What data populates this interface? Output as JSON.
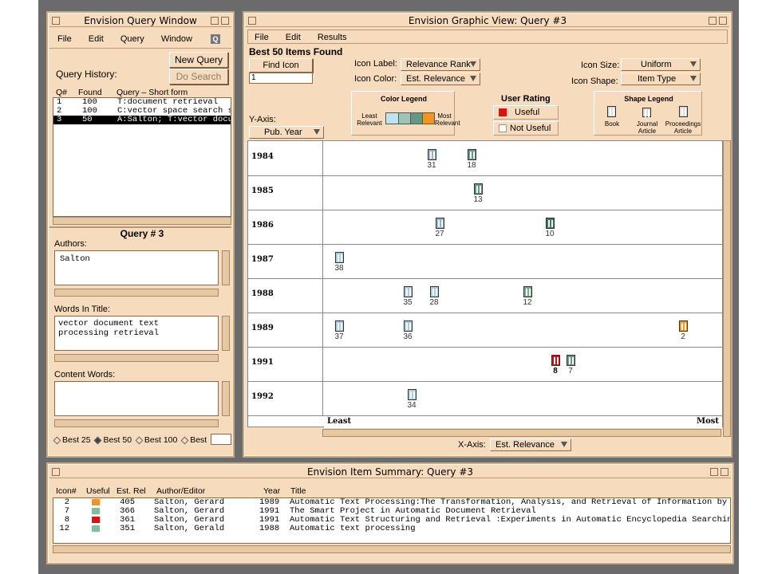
{
  "query_window": {
    "title": "Envision Query Window",
    "menu": [
      "File",
      "Edit",
      "Query",
      "Window"
    ],
    "q_badge": "Q",
    "new_query": "New Query",
    "do_search": "Do Search",
    "history_label": "Query History:",
    "history_headers": [
      "Q#",
      "Found",
      "Query – Short form"
    ],
    "history": [
      {
        "q": "1",
        "found": "100",
        "text": "T:document retrieval"
      },
      {
        "q": "2",
        "found": "100",
        "text": "C:vector space search s"
      },
      {
        "q": "3",
        "found": "50",
        "text": "A:Salton; T:vector docu"
      }
    ],
    "query_title": "Query # 3",
    "authors_label": "Authors:",
    "authors_value": "Salton",
    "title_label": "Words In Title:",
    "title_value_1": "vector document text",
    "title_value_2": "processing retrieval",
    "content_label": "Content Words:",
    "content_value": "",
    "best_options": [
      "Best 25",
      "Best 50",
      "Best 100",
      "Best"
    ]
  },
  "graphic_view": {
    "title": "Envision Graphic View: Query #3",
    "menu": [
      "File",
      "Edit",
      "Results"
    ],
    "heading": "Best 50 Items Found",
    "find_icon": "Find Icon",
    "find_value": "1",
    "icon_label_label": "Icon Label:",
    "icon_label_value": "Relevance Rank",
    "icon_color_label": "Icon Color:",
    "icon_color_value": "Est. Relevance",
    "icon_size_label": "Icon Size:",
    "icon_size_value": "Uniform",
    "icon_shape_label": "Icon Shape:",
    "icon_shape_value": "Item Type",
    "color_legend": {
      "title": "Color Legend",
      "least": "Least Relevant",
      "most": "Most Relevant",
      "colors": [
        "#bfe3f0",
        "#9cc6b4",
        "#5f9a82",
        "#f0951e"
      ]
    },
    "user_rating": {
      "title": "User Rating",
      "useful": "Useful",
      "not_useful": "Not Useful",
      "useful_color": "#e01010"
    },
    "shape_legend": {
      "title": "Shape Legend",
      "items": [
        "Book",
        "Journal Article",
        "Proceedings Article"
      ]
    },
    "yaxis_label": "Y-Axis:",
    "yaxis_value": "Pub. Year",
    "xaxis_label": "X-Axis:",
    "xaxis_value": "Est. Relevance",
    "x_least": "Least",
    "x_most": "Most",
    "rows": [
      "1984",
      "1985",
      "1986",
      "1987",
      "1988",
      "1989",
      "1991",
      "1992"
    ],
    "icons": [
      {
        "row": 0,
        "x": 0.26,
        "label": "31",
        "color": "#8fb4cc",
        "bold": false
      },
      {
        "row": 0,
        "x": 0.36,
        "label": "18",
        "color": "#5f9a82",
        "bold": false
      },
      {
        "row": 1,
        "x": 0.375,
        "label": "13",
        "color": "#5f9a82",
        "bold": false
      },
      {
        "row": 2,
        "x": 0.28,
        "label": "27",
        "color": "#8fb4cc",
        "bold": false
      },
      {
        "row": 2,
        "x": 0.555,
        "label": "10",
        "color": "#3f7a62",
        "bold": false
      },
      {
        "row": 3,
        "x": 0.027,
        "label": "38",
        "color": "#a8cde0",
        "bold": false
      },
      {
        "row": 4,
        "x": 0.2,
        "label": "35",
        "color": "#a8cde0",
        "bold": false
      },
      {
        "row": 4,
        "x": 0.265,
        "label": "28",
        "color": "#a8cde0",
        "bold": false
      },
      {
        "row": 4,
        "x": 0.5,
        "label": "12",
        "color": "#6fb08a",
        "bold": false
      },
      {
        "row": 5,
        "x": 0.027,
        "label": "37",
        "color": "#a8cde0",
        "bold": false
      },
      {
        "row": 5,
        "x": 0.2,
        "label": "36",
        "color": "#a8cde0",
        "bold": false
      },
      {
        "row": 5,
        "x": 0.89,
        "label": "2",
        "color": "#f0951e",
        "bold": false
      },
      {
        "row": 6,
        "x": 0.57,
        "label": "8",
        "color": "#cc1010",
        "bold": true
      },
      {
        "row": 6,
        "x": 0.607,
        "label": "7",
        "color": "#5f9a82",
        "bold": false
      },
      {
        "row": 7,
        "x": 0.21,
        "label": "34",
        "color": "#a8cde0",
        "bold": false
      }
    ]
  },
  "summary": {
    "title": "Envision Item Summary: Query #3",
    "headers": [
      "Icon#",
      "Useful",
      "Est. Rel",
      "Author/Editor",
      "Year",
      "Title"
    ],
    "rows": [
      {
        "icon": "2",
        "color": "#f0951e",
        "rel": "405",
        "author": "Salton, Gerard",
        "year": "1989",
        "title": "Automatic Text Processing:The Transformation, Analysis, and Retrieval of Information by C"
      },
      {
        "icon": "7",
        "color": "#7fbf9a",
        "rel": "366",
        "author": "Salton, Gerard",
        "year": "1991",
        "title": "The Smart Project in Automatic Document Retrieval"
      },
      {
        "icon": "8",
        "color": "#e01010",
        "rel": "361",
        "author": "Salton, Gerard",
        "year": "1991",
        "title": "Automatic Text Structuring and Retrieval :Experiments in Automatic Encyclopedia Searchin"
      },
      {
        "icon": "12",
        "color": "#7fbf9a",
        "rel": "351",
        "author": "Salton, Gerald",
        "year": "1988",
        "title": "Automatic text processing"
      }
    ]
  }
}
